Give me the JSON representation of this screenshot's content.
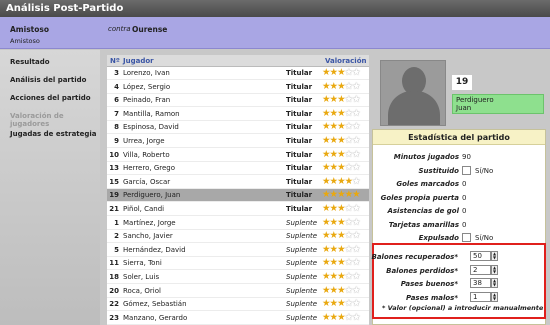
{
  "window": {
    "title": "Análisis Post-Partido"
  },
  "match": {
    "home_team": "Amistoso",
    "competition": "Amistoso",
    "contra": "contra",
    "away_team": "Ourense"
  },
  "menu": [
    {
      "label": "Resultado",
      "enabled": true
    },
    {
      "label": "Análisis del partido",
      "enabled": true
    },
    {
      "label": "Acciones del partido",
      "enabled": true
    },
    {
      "label": "Valoración de jugadores",
      "enabled": false
    },
    {
      "label": "Jugadas de estrategia",
      "enabled": true
    }
  ],
  "table": {
    "headers": {
      "num": "Nº",
      "player": "Jugador",
      "rating": "Valoración"
    },
    "rows": [
      {
        "num": "3",
        "name": "Lorenzo, Ivan",
        "role": "Titular",
        "stars": 3
      },
      {
        "num": "4",
        "name": "López, Sergio",
        "role": "Titular",
        "stars": 3
      },
      {
        "num": "6",
        "name": "Peinado, Fran",
        "role": "Titular",
        "stars": 3
      },
      {
        "num": "7",
        "name": "Mantilla, Ramon",
        "role": "Titular",
        "stars": 3
      },
      {
        "num": "8",
        "name": "Espinosa, David",
        "role": "Titular",
        "stars": 3
      },
      {
        "num": "9",
        "name": "Urrea, Jorge",
        "role": "Titular",
        "stars": 3
      },
      {
        "num": "10",
        "name": "Villa, Roberto",
        "role": "Titular",
        "stars": 3
      },
      {
        "num": "13",
        "name": "Herrero, Grego",
        "role": "Titular",
        "stars": 3
      },
      {
        "num": "15",
        "name": "García, Oscar",
        "role": "Titular",
        "stars": 4
      },
      {
        "num": "19",
        "name": "Perdiguero, Juan",
        "role": "Titular",
        "stars": 5,
        "selected": true
      },
      {
        "num": "21",
        "name": "Piñol, Candi",
        "role": "Titular",
        "stars": 3
      },
      {
        "num": "1",
        "name": "Martínez, Jorge",
        "role": "Suplente",
        "stars": 3
      },
      {
        "num": "2",
        "name": "Sancho, Javier",
        "role": "Suplente",
        "stars": 3
      },
      {
        "num": "5",
        "name": "Hernández, David",
        "role": "Suplente",
        "stars": 3
      },
      {
        "num": "11",
        "name": "Sierra, Toni",
        "role": "Suplente",
        "stars": 3
      },
      {
        "num": "18",
        "name": "Soler, Luis",
        "role": "Suplente",
        "stars": 3
      },
      {
        "num": "20",
        "name": "Roca, Oriol",
        "role": "Suplente",
        "stars": 3
      },
      {
        "num": "22",
        "name": "Gómez, Sebastián",
        "role": "Suplente",
        "stars": 3
      },
      {
        "num": "23",
        "name": "Manzano, Gerardo",
        "role": "Suplente",
        "stars": 3
      }
    ]
  },
  "player": {
    "number": "19",
    "position": "Perdiguero",
    "first_name": "Juan"
  },
  "stats": {
    "title": "Estadística del partido",
    "rows": [
      {
        "label": "Minutos jugados",
        "value": "90"
      },
      {
        "label": "Sustituido",
        "checkbox": true,
        "value": "Sí/No"
      },
      {
        "label": "Goles marcados",
        "value": "0"
      },
      {
        "label": "Goles propia puerta",
        "value": "0"
      },
      {
        "label": "Asistencias de gol",
        "value": "0"
      },
      {
        "label": "Tarjetas amarillas",
        "value": "0"
      },
      {
        "label": "Expulsado",
        "checkbox": true,
        "value": "Sí/No"
      }
    ],
    "manual": [
      {
        "label": "Balones recuperados*",
        "value": "50"
      },
      {
        "label": "Balones perdidos*",
        "value": "2"
      },
      {
        "label": "Pases buenos*",
        "value": "38"
      },
      {
        "label": "Pases malos*",
        "value": "1"
      }
    ],
    "note": "* Valor (opcional) a introducir manualmente"
  },
  "colors": {
    "star": "#e9a80f",
    "highlight": "#e0201c",
    "position_badge": "#8ee08e"
  }
}
